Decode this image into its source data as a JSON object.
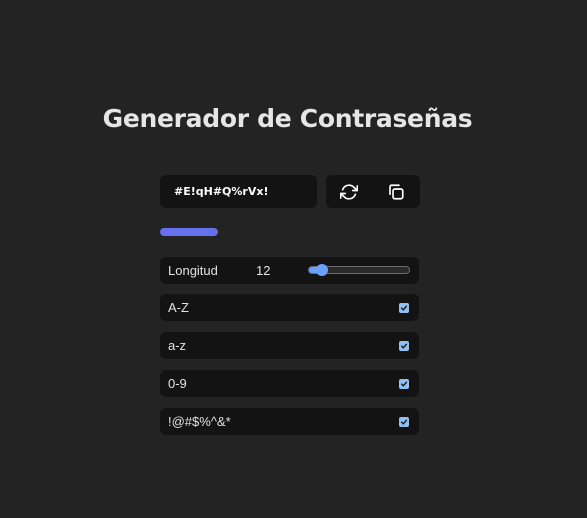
{
  "title": "Generador de Contraseñas",
  "password": {
    "value": "#E!qH#Q%rVx!"
  },
  "actions": {
    "refresh_icon": "refresh-icon",
    "copy_icon": "copy-icon"
  },
  "strength": {
    "level": 1.0,
    "color": "#6670ee"
  },
  "length": {
    "label": "Longitud",
    "value": "12",
    "min": 4,
    "max": 64
  },
  "options": [
    {
      "label": "A-Z",
      "checked": true
    },
    {
      "label": "a-z",
      "checked": true
    },
    {
      "label": "0-9",
      "checked": true
    },
    {
      "label": "!@#$%^&*",
      "checked": true
    }
  ],
  "colors": {
    "background": "#232323",
    "card": "#131313",
    "accent": "#6aa0ff",
    "checkbox": "#93c0f2"
  }
}
